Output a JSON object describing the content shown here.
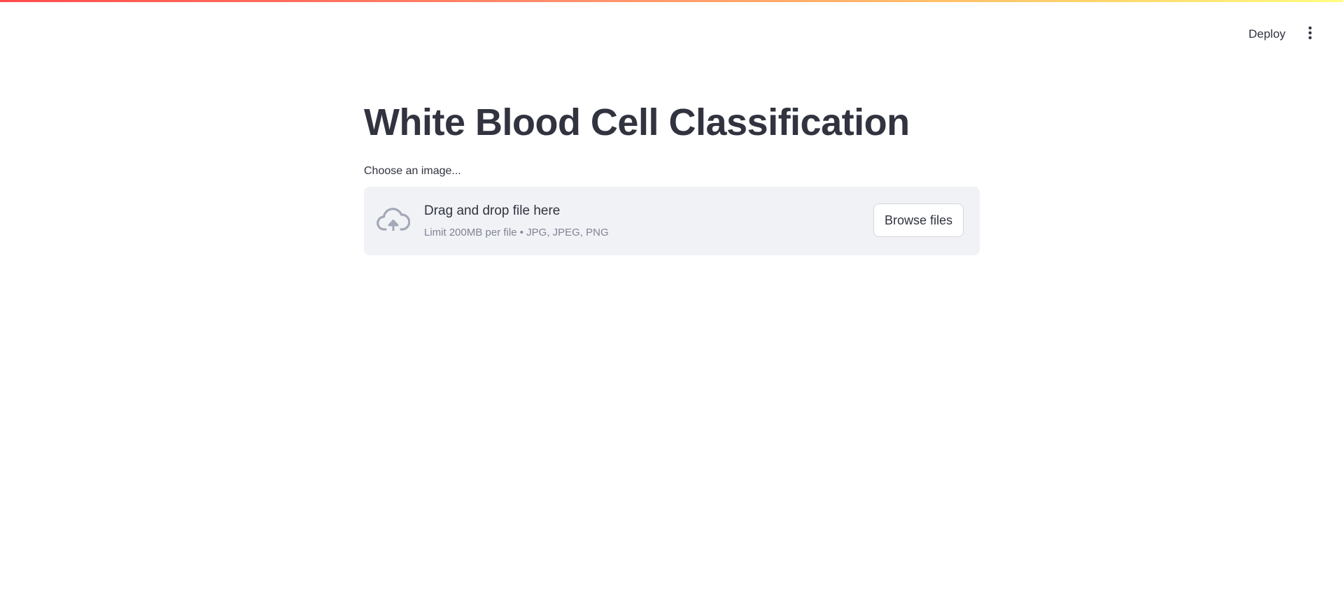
{
  "header": {
    "deploy_label": "Deploy",
    "menu_icon": "vertical-ellipsis-icon"
  },
  "main": {
    "title": "White Blood Cell Classification",
    "uploader": {
      "label": "Choose an image...",
      "drop_title": "Drag and drop file here",
      "limit_text": "Limit 200MB per file • JPG, JPEG, PNG",
      "browse_label": "Browse files",
      "icon": "cloud-upload-icon"
    }
  },
  "colors": {
    "text": "#31333f",
    "muted": "#808495",
    "dropzone_bg": "#f0f2f6",
    "icon": "#a3a8b8",
    "accent_gradient_start": "#ff4b4b",
    "accent_gradient_end": "#fffd80"
  }
}
